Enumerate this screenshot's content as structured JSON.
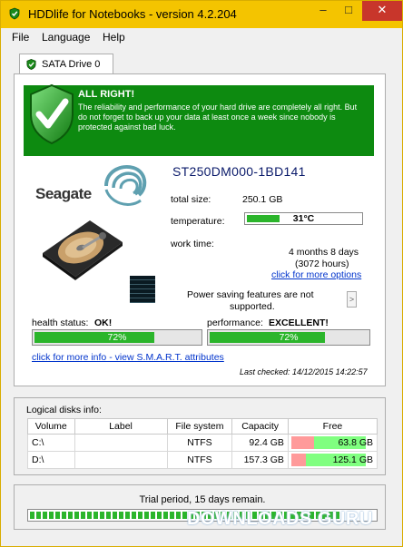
{
  "window": {
    "title": "HDDlife for Notebooks - version 4.2.204",
    "colors": {
      "titlebar": "#f4c400",
      "close": "#c8362b",
      "ok_green": "#0d8a10",
      "bar_green": "#2bb52b"
    }
  },
  "menu": {
    "file": "File",
    "language": "Language",
    "help": "Help"
  },
  "tab": {
    "label": "SATA Drive 0"
  },
  "status": {
    "title": "ALL RIGHT!",
    "text": "The reliability and performance of your hard drive are completely all right. But do not forget to back up your data at least once a week since nobody is protected against bad luck."
  },
  "drive": {
    "brand": "Seagate",
    "model": "ST250DM000-1BD141",
    "total_size_label": "total size:",
    "total_size": "250.1 GB",
    "temperature_label": "temperature:",
    "temperature": "31°C",
    "temperature_fill": 0.28,
    "work_time_label": "work time:",
    "work_time": "4 months 8 days",
    "work_hours": "(3072 hours)",
    "more_options": "click for more options",
    "power_saving": "Power saving features are not supported.",
    "health_label": "health status:",
    "health_value": "OK!",
    "health_percent": "72%",
    "health_fill": 0.72,
    "performance_label": "performance:",
    "performance_value": "EXCELLENT!",
    "performance_percent": "72%",
    "performance_fill": 0.72,
    "smart_link": "click for more info - view S.M.A.R.T. attributes",
    "last_checked": "Last checked:  14/12/2015 14:22:57"
  },
  "logical": {
    "title": "Logical disks info:",
    "headers": [
      "Volume",
      "Label",
      "File system",
      "Capacity",
      "Free"
    ],
    "rows": [
      {
        "volume": "C:\\",
        "label": "",
        "fs": "NTFS",
        "capacity": "92.4 GB",
        "free": "63.8 GB",
        "used_fraction": 0.31
      },
      {
        "volume": "D:\\",
        "label": "",
        "fs": "NTFS",
        "capacity": "157.3 GB",
        "free": "125.1 GB",
        "used_fraction": 0.2
      }
    ]
  },
  "trial": {
    "text": "Trial period, 15 days remain.",
    "fill": 0.9
  },
  "watermark": "DOWNLOADS  GURU",
  "icons": [
    "app-icon",
    "minimize-icon",
    "maximize-icon",
    "close-icon",
    "shield-check-icon",
    "seagate-swirl-icon",
    "hard-drive-icon",
    "chevron-right-icon"
  ]
}
